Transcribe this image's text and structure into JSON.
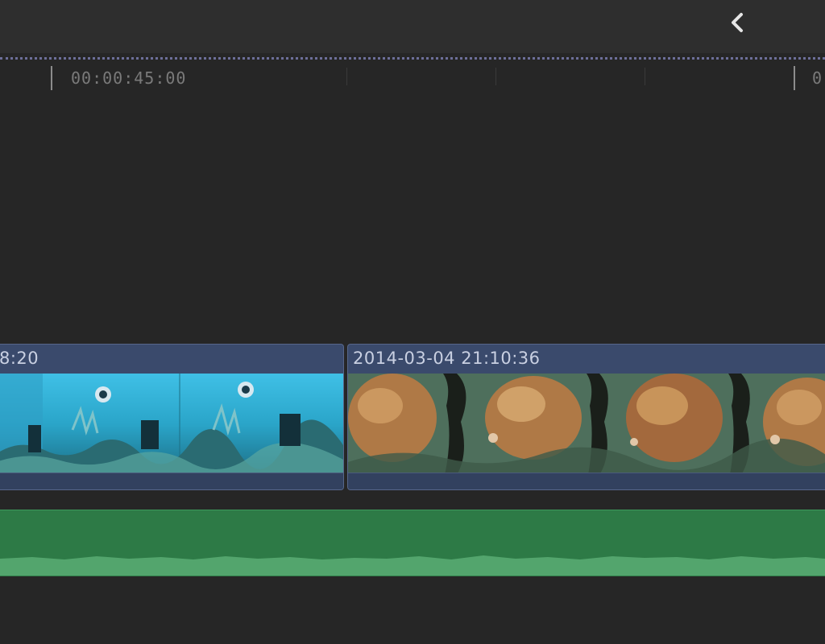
{
  "ruler": {
    "timecode_1": "00:00:45:00",
    "timecode_2": "0"
  },
  "clips": [
    {
      "title": "8:20",
      "thumbnail_scene": "underwater-diver-blue"
    },
    {
      "title": "2014-03-04 21:10:36",
      "thumbnail_scene": "coral-reef-orange"
    }
  ],
  "colors": {
    "background": "#262626",
    "video_clip": "#3a4a6c",
    "audio_track": "#2d7a46",
    "audio_wave": "#53a56d"
  },
  "icons": {
    "back": "chevron-left-icon"
  }
}
